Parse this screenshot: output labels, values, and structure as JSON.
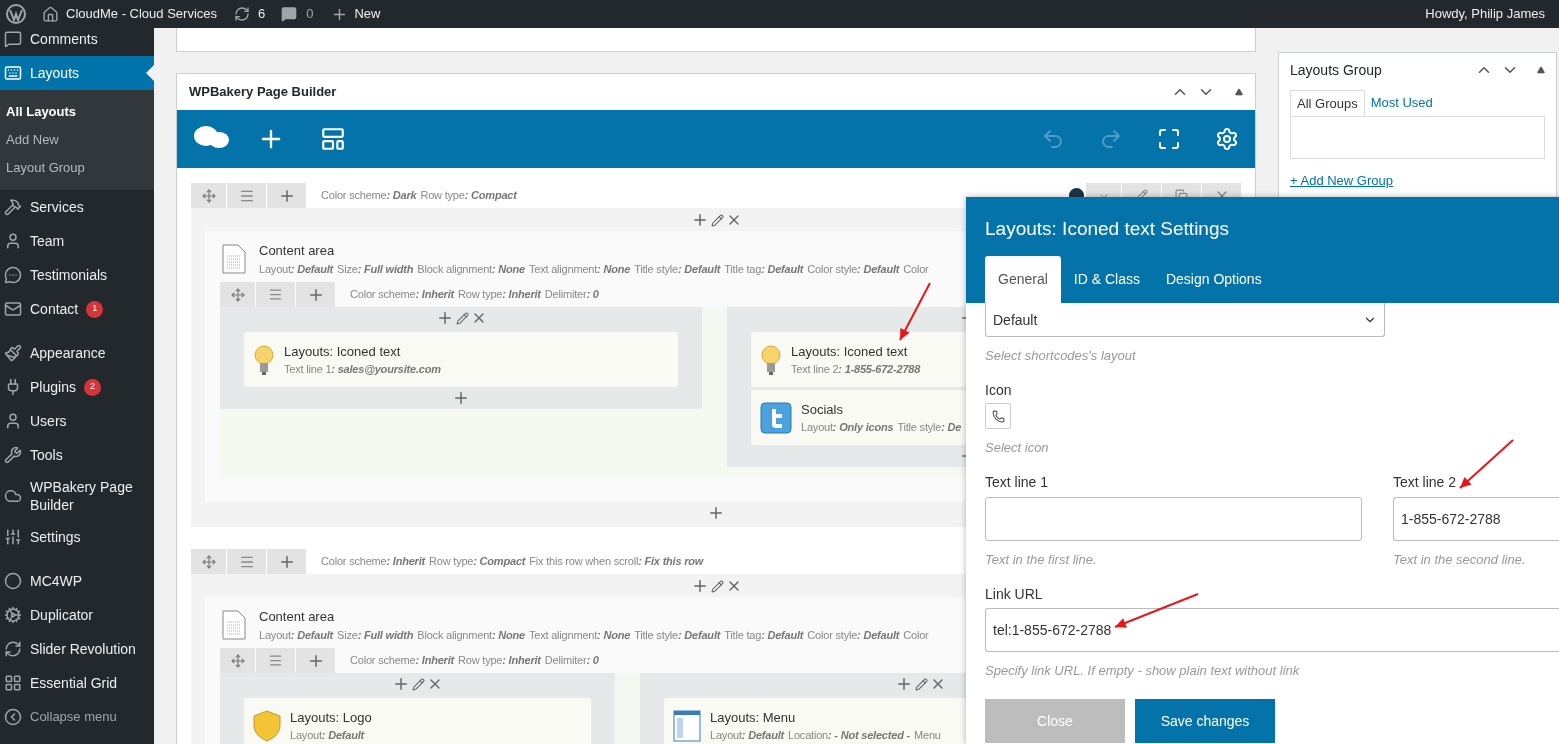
{
  "admin_bar": {
    "site": "CloudMe - Cloud Services",
    "updates": "6",
    "comments": "0",
    "new": "New",
    "greeting": "Howdy, Philip James"
  },
  "sidebar": {
    "groups": [
      [
        {
          "label": "Comments",
          "selected": false
        },
        {
          "label": "Layouts",
          "selected": true,
          "children": [
            {
              "label": "All Layouts",
              "selected": true
            },
            {
              "label": "Add New",
              "selected": false
            },
            {
              "label": "Layout Group",
              "selected": false
            }
          ]
        },
        {
          "label": "Services",
          "selected": false
        },
        {
          "label": "Team",
          "selected": false
        },
        {
          "label": "Testimonials",
          "selected": false
        },
        {
          "label": "Contact",
          "selected": false,
          "badge": "1"
        }
      ],
      [
        {
          "label": "Appearance",
          "selected": false
        },
        {
          "label": "Plugins",
          "selected": false,
          "badge": "2"
        },
        {
          "label": "Users",
          "selected": false
        },
        {
          "label": "Tools",
          "selected": false
        },
        {
          "label": "WPBakery Page Builder",
          "selected": false
        },
        {
          "label": "Settings",
          "selected": false
        }
      ],
      [
        {
          "label": "MC4WP",
          "selected": false
        },
        {
          "label": "Duplicator",
          "selected": false
        },
        {
          "label": "Slider Revolution",
          "selected": false
        },
        {
          "label": "Essential Grid",
          "selected": false
        }
      ]
    ],
    "collapse": "Collapse menu"
  },
  "builder": {
    "title": "WPBakery Page Builder",
    "rows": [
      {
        "meta": [
          {
            "label": "Color scheme",
            "value": ": Dark"
          },
          {
            "label": "Row type",
            "value": ": Compact"
          }
        ],
        "content": {
          "title": "Content area",
          "meta": [
            {
              "label": "Layout",
              "value": ": Default"
            },
            {
              "label": "Size",
              "value": ": Full width"
            },
            {
              "label": "Block alignment",
              "value": ": None"
            },
            {
              "label": "Text alignment",
              "value": ": None"
            },
            {
              "label": "Title style",
              "value": ": Default"
            },
            {
              "label": "Title tag",
              "value": ": Default"
            },
            {
              "label": "Color style",
              "value": ": Default"
            },
            {
              "label": "Color"
            }
          ],
          "inner_row": {
            "meta": [
              {
                "label": "Color scheme",
                "value": ": Inherit"
              },
              {
                "label": "Row type",
                "value": ": Inherit"
              },
              {
                "label": "Delimiter",
                "value": ": 0"
              }
            ],
            "columns": [
              {
                "elements": [
                  {
                    "kind": "iconed_text",
                    "title": "Layouts: Iconed text",
                    "meta": [
                      {
                        "label": "Text line 1",
                        "value": ": sales@yoursite.com"
                      }
                    ]
                  }
                ]
              },
              {
                "elements": [
                  {
                    "kind": "iconed_text",
                    "title": "Layouts: Iconed text",
                    "meta": [
                      {
                        "label": "Text line 2",
                        "value": ": 1-855-672-2788"
                      }
                    ]
                  },
                  {
                    "kind": "socials",
                    "title": "Socials",
                    "meta": [
                      {
                        "label": "Layout",
                        "value": ": Only icons"
                      },
                      {
                        "label": "Title style",
                        "value": ": De"
                      }
                    ]
                  }
                ]
              }
            ]
          }
        }
      },
      {
        "meta": [
          {
            "label": "Color scheme",
            "value": ": Inherit"
          },
          {
            "label": "Row type",
            "value": ": Compact"
          },
          {
            "label": "Fix this row when scroll",
            "value": ": Fix this row"
          }
        ],
        "content": {
          "title": "Content area",
          "meta": [
            {
              "label": "Layout",
              "value": ": Default"
            },
            {
              "label": "Size",
              "value": ": Full width"
            },
            {
              "label": "Block alignment",
              "value": ": None"
            },
            {
              "label": "Text alignment",
              "value": ": None"
            },
            {
              "label": "Title style",
              "value": ": Default"
            },
            {
              "label": "Title tag",
              "value": ": Default"
            },
            {
              "label": "Color style",
              "value": ": Default"
            },
            {
              "label": "Color"
            }
          ],
          "inner_row": {
            "meta": [
              {
                "label": "Color scheme",
                "value": ": Inherit"
              },
              {
                "label": "Row type",
                "value": ": Inherit"
              },
              {
                "label": "Delimiter",
                "value": ": 0"
              }
            ],
            "columns": [
              {
                "elements": [
                  {
                    "kind": "logo",
                    "title": "Layouts: Logo",
                    "meta": [
                      {
                        "label": "Layout",
                        "value": ": Default"
                      }
                    ]
                  }
                ]
              },
              {
                "elements": [
                  {
                    "kind": "menu",
                    "title": "Layouts: Menu",
                    "meta": [
                      {
                        "label": "Layout",
                        "value": ": Default"
                      },
                      {
                        "label": "Location",
                        "value": ": - Not selected -"
                      },
                      {
                        "label": "Menu"
                      }
                    ]
                  }
                ]
              }
            ]
          }
        }
      }
    ]
  },
  "layouts_group": {
    "title": "Layouts Group",
    "tabs": [
      {
        "label": "All Groups",
        "selected": true
      },
      {
        "label": "Most Used",
        "selected": false
      }
    ],
    "add_link": "+ Add New Group"
  },
  "settings_modal": {
    "title": "Layouts: Iconed text Settings",
    "tabs": [
      {
        "label": "General",
        "selected": true
      },
      {
        "label": "ID & Class",
        "selected": false
      },
      {
        "label": "Design Options",
        "selected": false
      }
    ],
    "layout_select": {
      "value": "Default",
      "help": "Select shortcodes's layout"
    },
    "icon_field": {
      "label": "Icon",
      "help": "Select icon"
    },
    "text_line_1": {
      "label": "Text line 1",
      "help": "Text in the first line."
    },
    "text_line_2": {
      "label": "Text line 2",
      "value": "1-855-672-2788",
      "help": "Text in the second line."
    },
    "link_url": {
      "label": "Link URL",
      "value": "tel:1-855-672-2788",
      "help": "Specify link URL. If empty - show plain text without link"
    },
    "buttons": [
      {
        "label": "Close",
        "kind": "secondary"
      },
      {
        "label": "Save changes",
        "kind": "primary"
      }
    ]
  }
}
